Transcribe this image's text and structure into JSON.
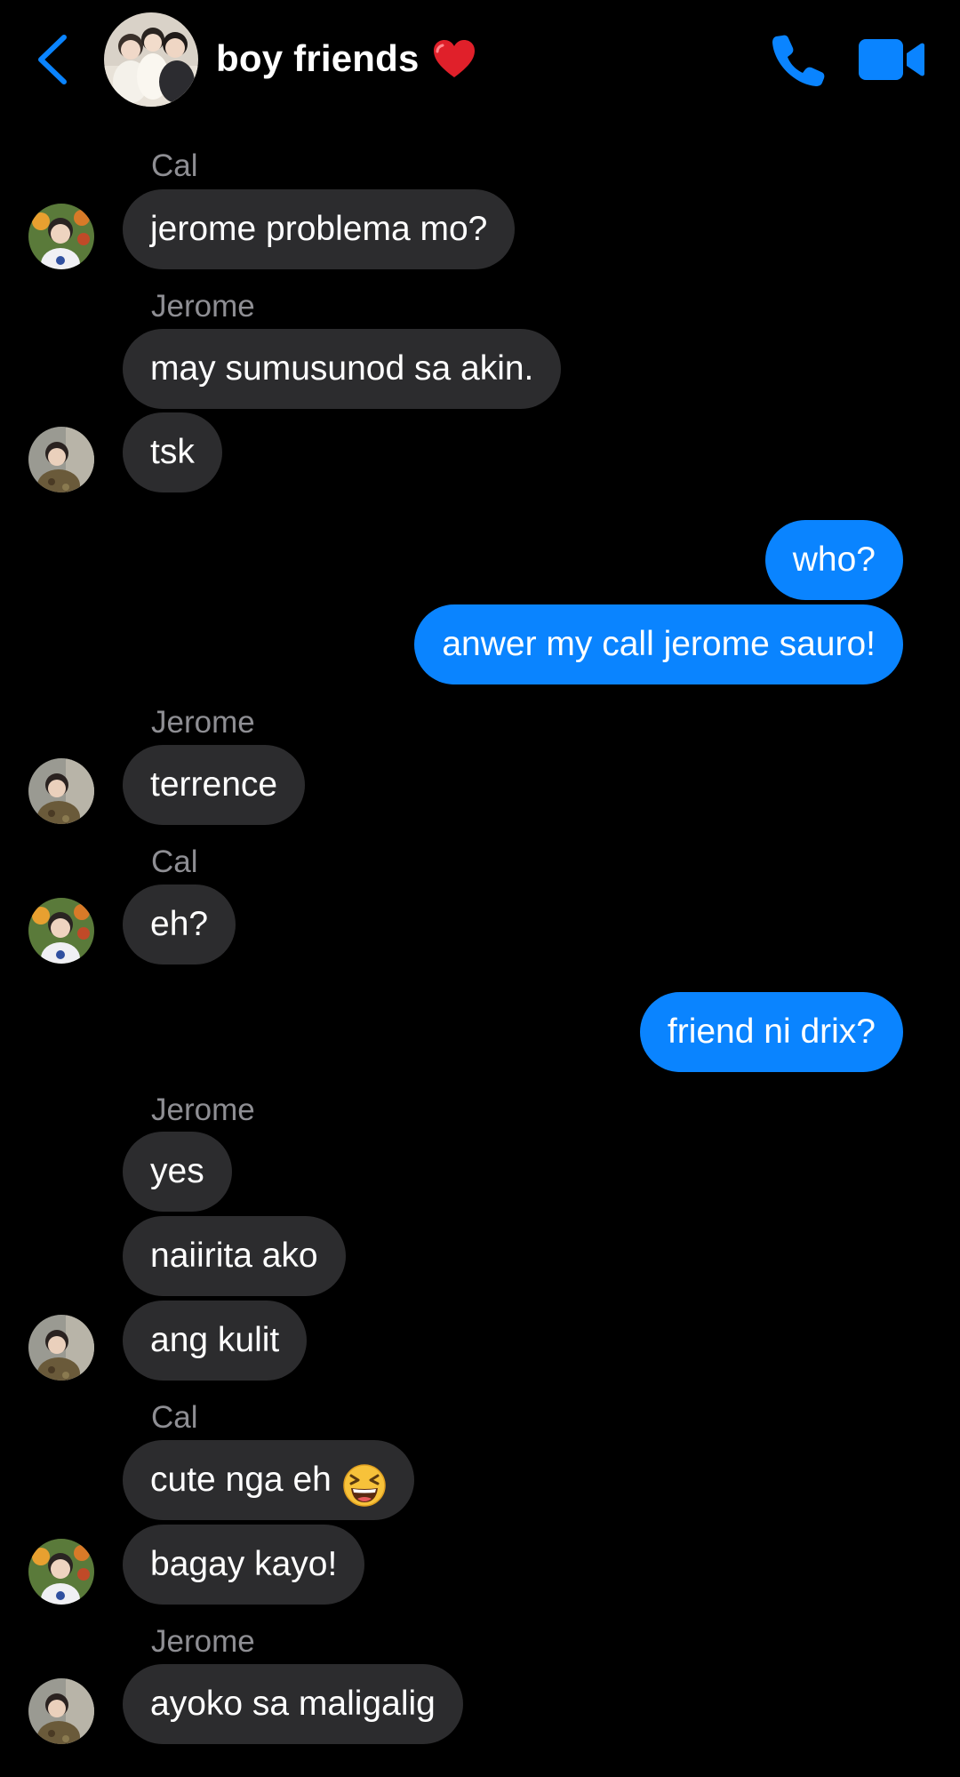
{
  "header": {
    "title": "boy friends",
    "title_emoji": "heart-icon",
    "back_icon": "chevron-left-icon",
    "call_icon": "phone-icon",
    "video_icon": "video-camera-icon",
    "accent_color": "#0a84ff"
  },
  "messages": [
    {
      "sender": "Cal",
      "text": "jerome problema mo?"
    },
    {
      "sender": "Jerome",
      "text": "may sumusunod sa akin."
    },
    {
      "text": "tsk"
    },
    {
      "text": "who?"
    },
    {
      "text": "anwer my call jerome sauro!"
    },
    {
      "sender": "Jerome",
      "text": "terrence"
    },
    {
      "sender": "Cal",
      "text": "eh?"
    },
    {
      "text": "friend ni drix?"
    },
    {
      "sender": "Jerome",
      "text": "yes"
    },
    {
      "text": "naiirita ako"
    },
    {
      "text": "ang kulit"
    },
    {
      "sender": "Cal",
      "text": "cute nga eh",
      "emoji": "grinning-squinting-face-icon"
    },
    {
      "text": "bagay kayo!"
    },
    {
      "sender": "Jerome",
      "text": "ayoko sa maligalig"
    }
  ],
  "colors": {
    "background": "#000000",
    "incoming_bubble": "#2c2c2e",
    "outgoing_bubble": "#0a84ff",
    "sender_name": "#8e8e93"
  }
}
